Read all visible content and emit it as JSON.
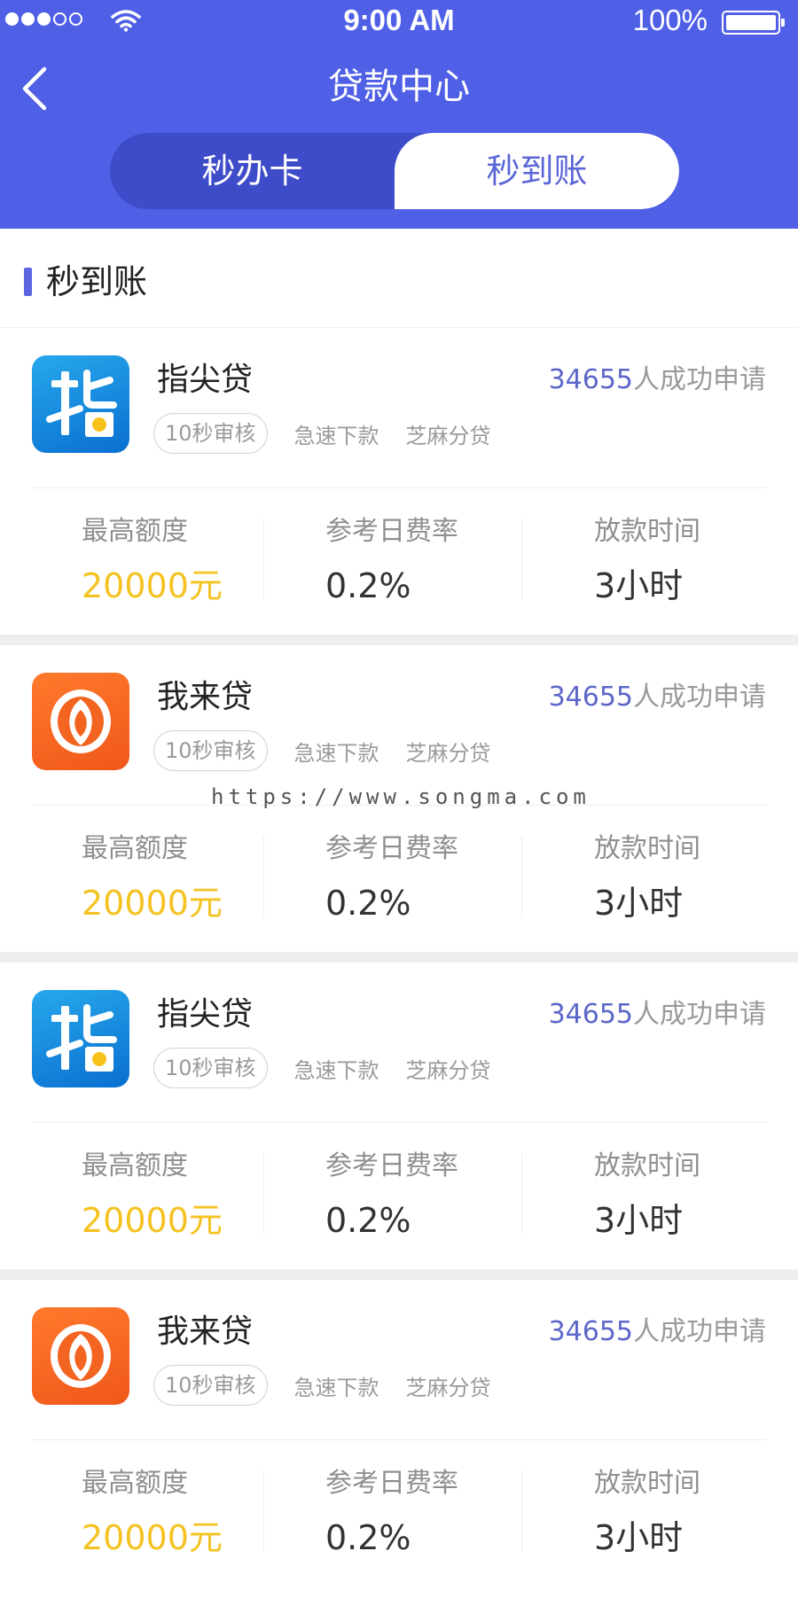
{
  "status_bar": {
    "time": "9:00 AM",
    "battery_percent": "100%",
    "signal_strength": 3
  },
  "header": {
    "title": "贷款中心",
    "back_icon": "chevron-left-icon",
    "tabs": [
      {
        "label": "秒办卡",
        "active": false
      },
      {
        "label": "秒到账",
        "active": true
      }
    ]
  },
  "section": {
    "title": "秒到账"
  },
  "loans": [
    {
      "name": "指尖贷",
      "logo": "zhi-logo",
      "applicant_count": "34655",
      "applicant_suffix": "人成功申请",
      "tags": [
        "10秒审核",
        "急速下款",
        "芝麻分贷"
      ],
      "max_amount_label": "最高额度",
      "max_amount": "20000元",
      "rate_label": "参考日费率",
      "rate": "0.2%",
      "time_label": "放款时间",
      "time": "3小时"
    },
    {
      "name": "我来贷",
      "logo": "wo-logo",
      "applicant_count": "34655",
      "applicant_suffix": "人成功申请",
      "tags": [
        "10秒审核",
        "急速下款",
        "芝麻分贷"
      ],
      "max_amount_label": "最高额度",
      "max_amount": "20000元",
      "rate_label": "参考日费率",
      "rate": "0.2%",
      "time_label": "放款时间",
      "time": "3小时"
    },
    {
      "name": "指尖贷",
      "logo": "zhi-logo",
      "applicant_count": "34655",
      "applicant_suffix": "人成功申请",
      "tags": [
        "10秒审核",
        "急速下款",
        "芝麻分贷"
      ],
      "max_amount_label": "最高额度",
      "max_amount": "20000元",
      "rate_label": "参考日费率",
      "rate": "0.2%",
      "time_label": "放款时间",
      "time": "3小时"
    },
    {
      "name": "我来贷",
      "logo": "wo-logo",
      "applicant_count": "34655",
      "applicant_suffix": "人成功申请",
      "tags": [
        "10秒审核",
        "急速下款",
        "芝麻分贷"
      ],
      "max_amount_label": "最高额度",
      "max_amount": "20000元",
      "rate_label": "参考日费率",
      "rate": "0.2%",
      "time_label": "放款时间",
      "time": "3小时"
    }
  ],
  "watermark": "https://www.songma.com",
  "colors": {
    "header_bg": "#4f5fe6",
    "tab_track": "#3f4cc9",
    "accent_text": "#5d67c8",
    "amount": "#f4c322",
    "zhi_logo": "#1a8ee0",
    "wo_logo": "#f26420"
  }
}
